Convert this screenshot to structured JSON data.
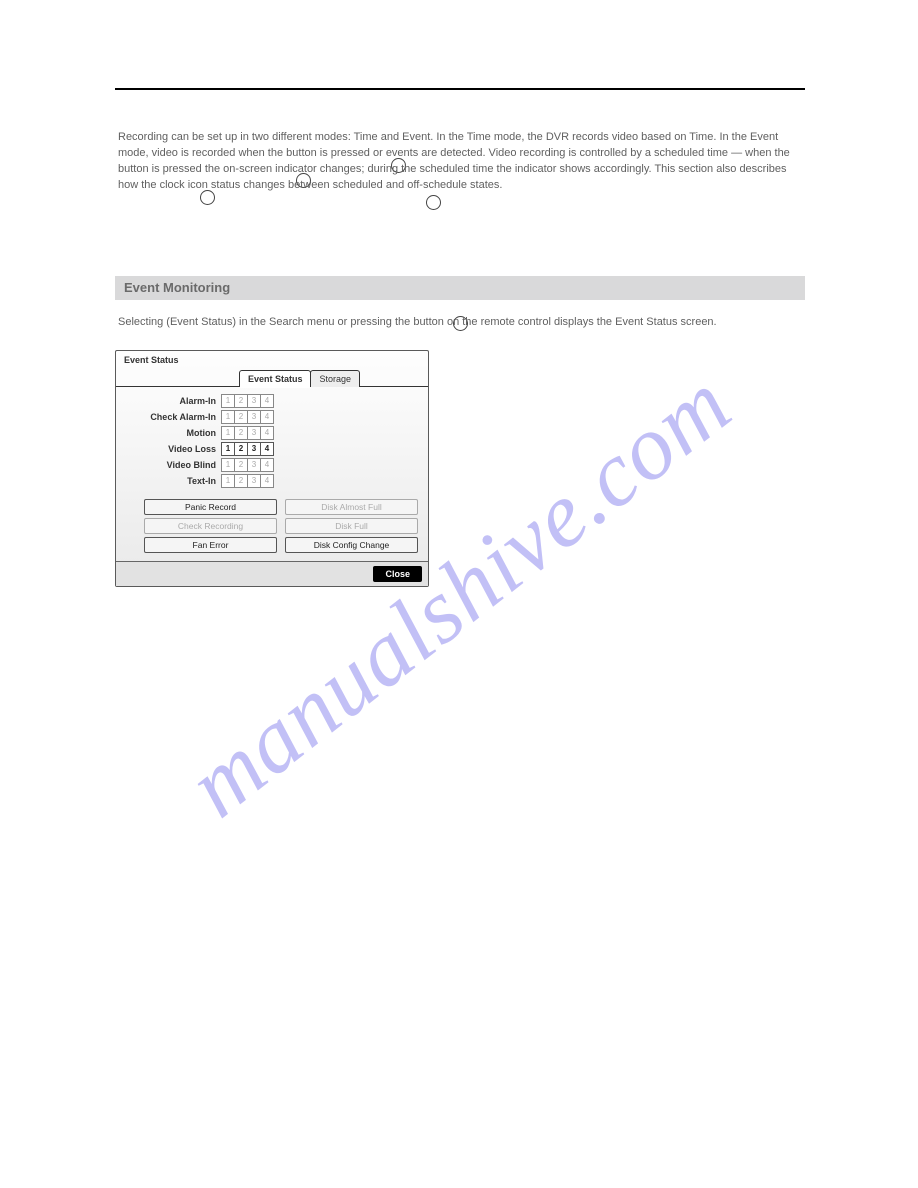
{
  "watermark": "manualshive.com",
  "prose": {
    "top": "Recording can be set up in two different modes: Time and Event. In the Time mode, the DVR records video based on Time. In the Event mode, video is recorded when the button is pressed or events are detected. Video recording is controlled by a scheduled time — when the button is pressed the on-screen indicator changes; during the scheduled time the indicator shows accordingly. This section also describes how the clock icon status changes between scheduled and off-schedule states.",
    "headrow": "Event Monitoring",
    "below": "Selecting (Event Status) in the Search menu or pressing the button on the remote control displays the Event Status screen."
  },
  "dialog": {
    "title": "Event Status",
    "tabs": [
      {
        "label": "Event Status",
        "active": true
      },
      {
        "label": "Storage",
        "active": false
      }
    ],
    "rows": [
      {
        "label": "Alarm-In",
        "cells": [
          {
            "v": "1",
            "a": false
          },
          {
            "v": "2",
            "a": false
          },
          {
            "v": "3",
            "a": false
          },
          {
            "v": "4",
            "a": false
          }
        ]
      },
      {
        "label": "Check Alarm-In",
        "cells": [
          {
            "v": "1",
            "a": false
          },
          {
            "v": "2",
            "a": false
          },
          {
            "v": "3",
            "a": false
          },
          {
            "v": "4",
            "a": false
          }
        ]
      },
      {
        "label": "Motion",
        "cells": [
          {
            "v": "1",
            "a": false
          },
          {
            "v": "2",
            "a": false
          },
          {
            "v": "3",
            "a": false
          },
          {
            "v": "4",
            "a": false
          }
        ]
      },
      {
        "label": "Video Loss",
        "cells": [
          {
            "v": "1",
            "a": true
          },
          {
            "v": "2",
            "a": true
          },
          {
            "v": "3",
            "a": true
          },
          {
            "v": "4",
            "a": true
          }
        ]
      },
      {
        "label": "Video Blind",
        "cells": [
          {
            "v": "1",
            "a": false
          },
          {
            "v": "2",
            "a": false
          },
          {
            "v": "3",
            "a": false
          },
          {
            "v": "4",
            "a": false
          }
        ]
      },
      {
        "label": "Text-In",
        "cells": [
          {
            "v": "1",
            "a": false
          },
          {
            "v": "2",
            "a": false
          },
          {
            "v": "3",
            "a": false
          },
          {
            "v": "4",
            "a": false
          }
        ]
      }
    ],
    "status": [
      {
        "label": "Panic Record",
        "dim": false
      },
      {
        "label": "Disk Almost Full",
        "dim": true
      },
      {
        "label": "Check Recording",
        "dim": true
      },
      {
        "label": "Disk Full",
        "dim": true
      },
      {
        "label": "Fan Error",
        "dim": false
      },
      {
        "label": "Disk Config Change",
        "dim": false
      }
    ],
    "close": "Close"
  }
}
